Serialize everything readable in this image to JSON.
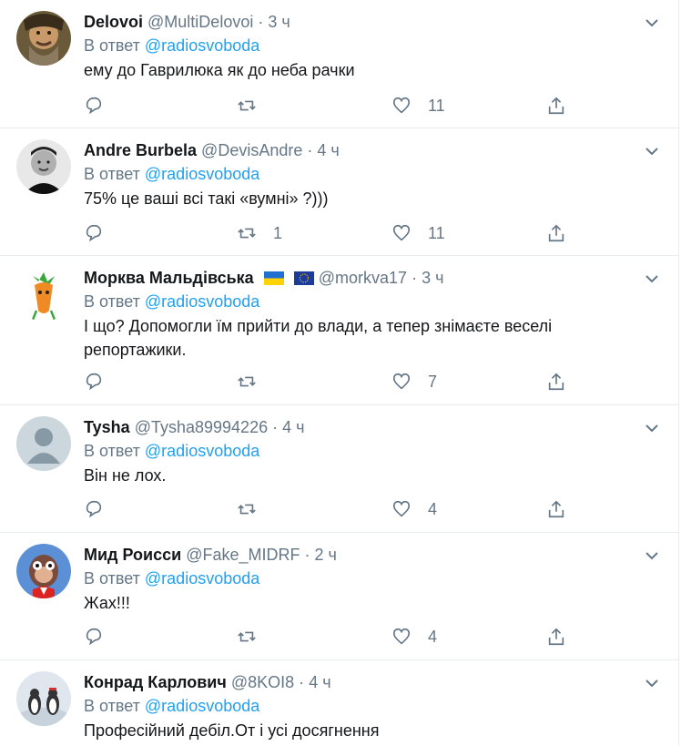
{
  "reply_prefix": "В ответ",
  "tweets": [
    {
      "name": "Delovoi",
      "handle": "@MultiDelovoi",
      "sep": "·",
      "time": "3 ч",
      "mention": "@radiosvoboda",
      "text": "ему до Гаврилюка як до неба рачки",
      "retweets": "",
      "likes": "11"
    },
    {
      "name": "Andre Burbela",
      "handle": "@DevisAndre",
      "sep": "·",
      "time": "4 ч",
      "mention": "@radiosvoboda",
      "text": "75% це ваші всі такі «вумні» ?)))",
      "retweets": "1",
      "likes": "11"
    },
    {
      "name": "Морква Мальдівська",
      "handle": "@morkva17",
      "sep": "·",
      "time": "3 ч",
      "mention": "@radiosvoboda",
      "text": "І що? Допомогли їм прийти до влади, а тепер знімаєте веселі репортажики.",
      "retweets": "",
      "likes": "7"
    },
    {
      "name": "Tysha",
      "handle": "@Tysha89994226",
      "sep": "·",
      "time": "4 ч",
      "mention": "@radiosvoboda",
      "text": "Він не лох.",
      "retweets": "",
      "likes": "4"
    },
    {
      "name": "Мид Роисси",
      "handle": "@Fake_MIDRF",
      "sep": "·",
      "time": "2 ч",
      "mention": "@radiosvoboda",
      "text": "Жах!!!",
      "retweets": "",
      "likes": "4"
    },
    {
      "name": "Конрад Карлович",
      "handle": "@8KOI8",
      "sep": "·",
      "time": "4 ч",
      "mention": "@radiosvoboda",
      "text": "Професійний дебіл.От і усі досягнення",
      "retweets": "",
      "likes": ""
    }
  ],
  "colors": {
    "link": "#1da1f2",
    "muted": "#657786",
    "border": "#e6ecf0"
  },
  "icons": [
    "reply-icon",
    "retweet-icon",
    "like-icon",
    "share-icon",
    "chevron-down-icon",
    "ukraine-flag-icon",
    "eu-flag-icon"
  ]
}
